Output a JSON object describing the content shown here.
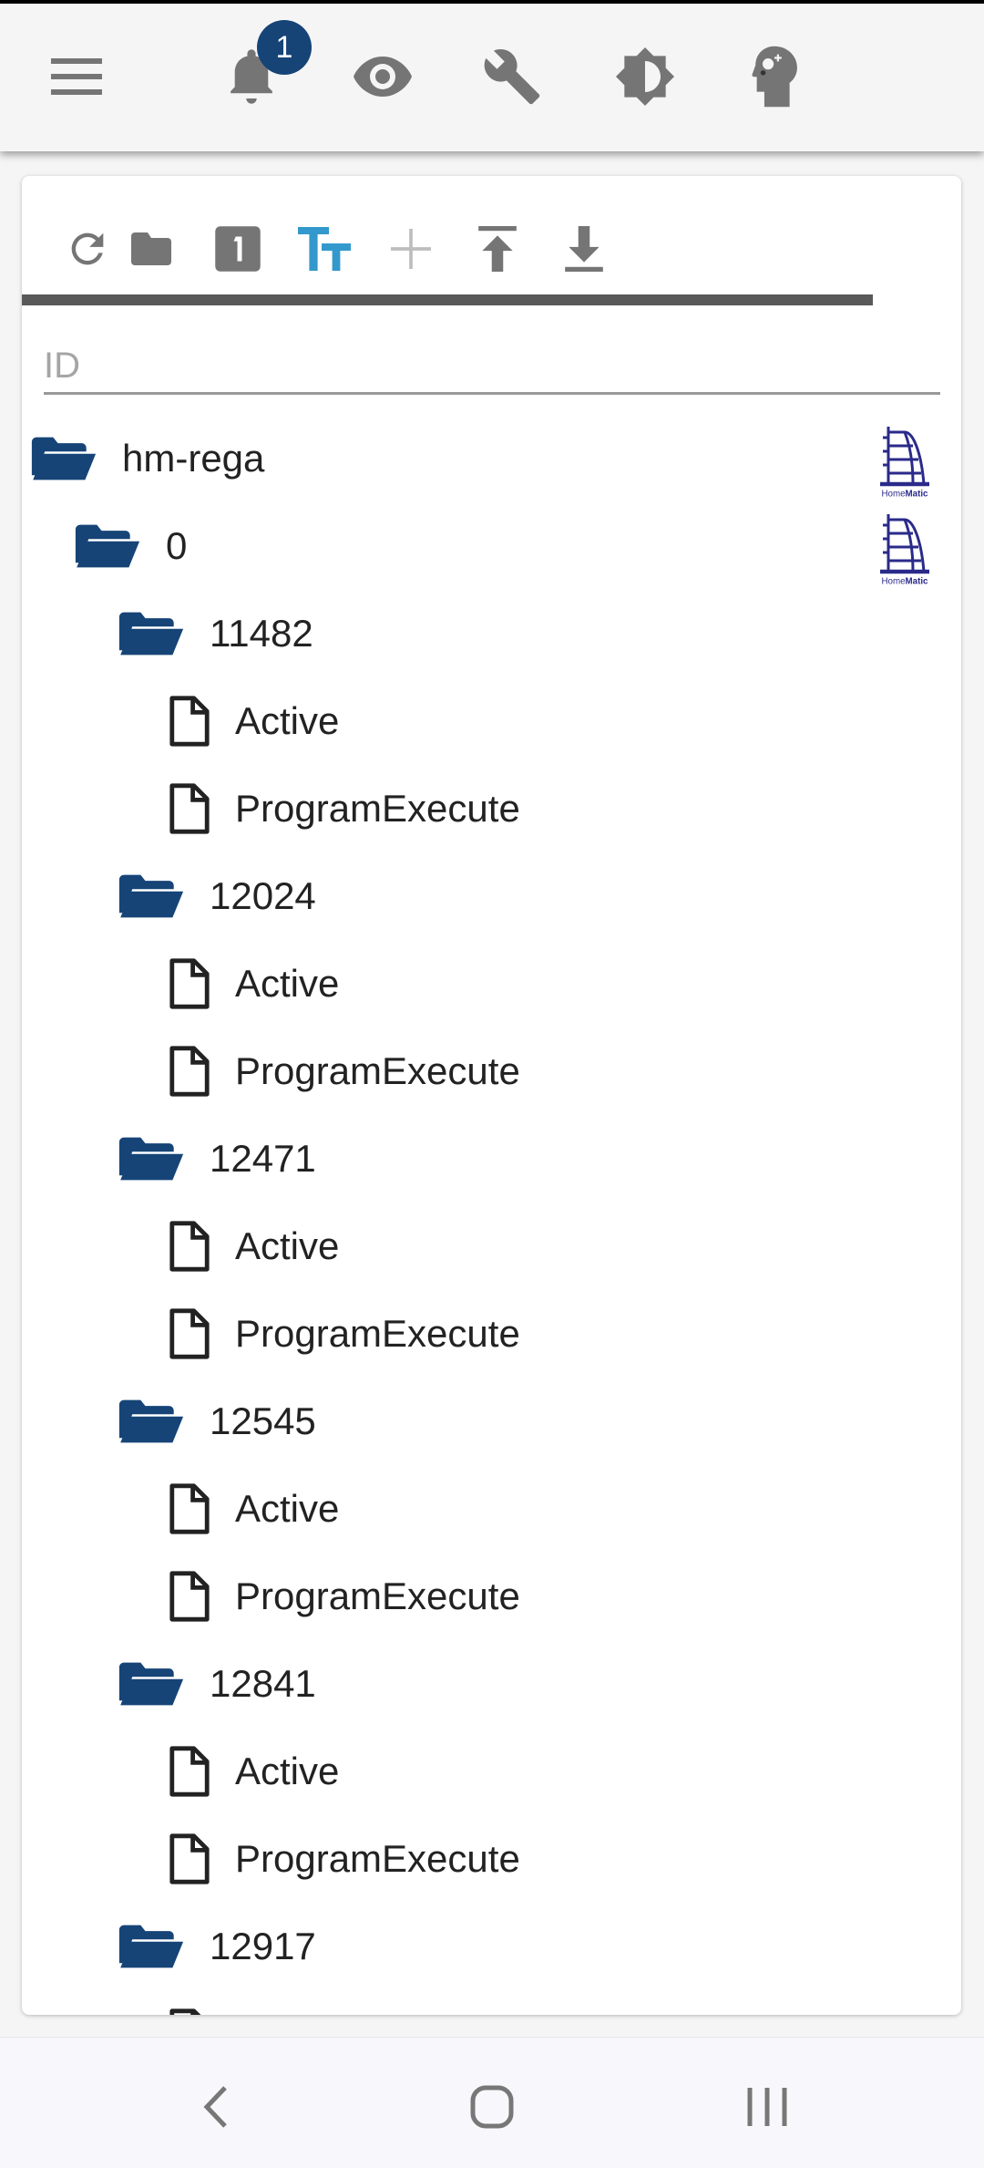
{
  "header": {
    "icons": [
      "menu-icon",
      "bell-icon",
      "eye-icon",
      "wrench-icon",
      "brightness-icon",
      "head-icon"
    ],
    "notification_count": "1"
  },
  "toolbar": {
    "icons": [
      "refresh-icon",
      "folder-icon",
      "numeric-1-box-icon",
      "text-size-icon",
      "plus-icon",
      "upload-icon",
      "download-icon"
    ],
    "active_color": "#3399cc"
  },
  "search": {
    "placeholder": "ID",
    "value": ""
  },
  "tree": [
    {
      "label": "hm-rega",
      "type": "folder",
      "level": 0,
      "logo": "HomeMatic"
    },
    {
      "label": "0",
      "type": "folder",
      "level": 1,
      "logo": "HomeMatic"
    },
    {
      "label": "11482",
      "type": "folder",
      "level": 2
    },
    {
      "label": "Active",
      "type": "state",
      "level": 3
    },
    {
      "label": "ProgramExecute",
      "type": "state",
      "level": 3
    },
    {
      "label": "12024",
      "type": "folder",
      "level": 2
    },
    {
      "label": "Active",
      "type": "state",
      "level": 3
    },
    {
      "label": "ProgramExecute",
      "type": "state",
      "level": 3
    },
    {
      "label": "12471",
      "type": "folder",
      "level": 2
    },
    {
      "label": "Active",
      "type": "state",
      "level": 3
    },
    {
      "label": "ProgramExecute",
      "type": "state",
      "level": 3
    },
    {
      "label": "12545",
      "type": "folder",
      "level": 2
    },
    {
      "label": "Active",
      "type": "state",
      "level": 3
    },
    {
      "label": "ProgramExecute",
      "type": "state",
      "level": 3
    },
    {
      "label": "12841",
      "type": "folder",
      "level": 2
    },
    {
      "label": "Active",
      "type": "state",
      "level": 3
    },
    {
      "label": "ProgramExecute",
      "type": "state",
      "level": 3
    },
    {
      "label": "12917",
      "type": "folder",
      "level": 2
    },
    {
      "label": "",
      "type": "state",
      "level": 3
    }
  ],
  "colors": {
    "folder": "#164477",
    "badge": "#164477",
    "logo": "#2a2a8a"
  },
  "navbar": {
    "icons": [
      "back-icon",
      "home-icon",
      "recents-icon"
    ]
  }
}
